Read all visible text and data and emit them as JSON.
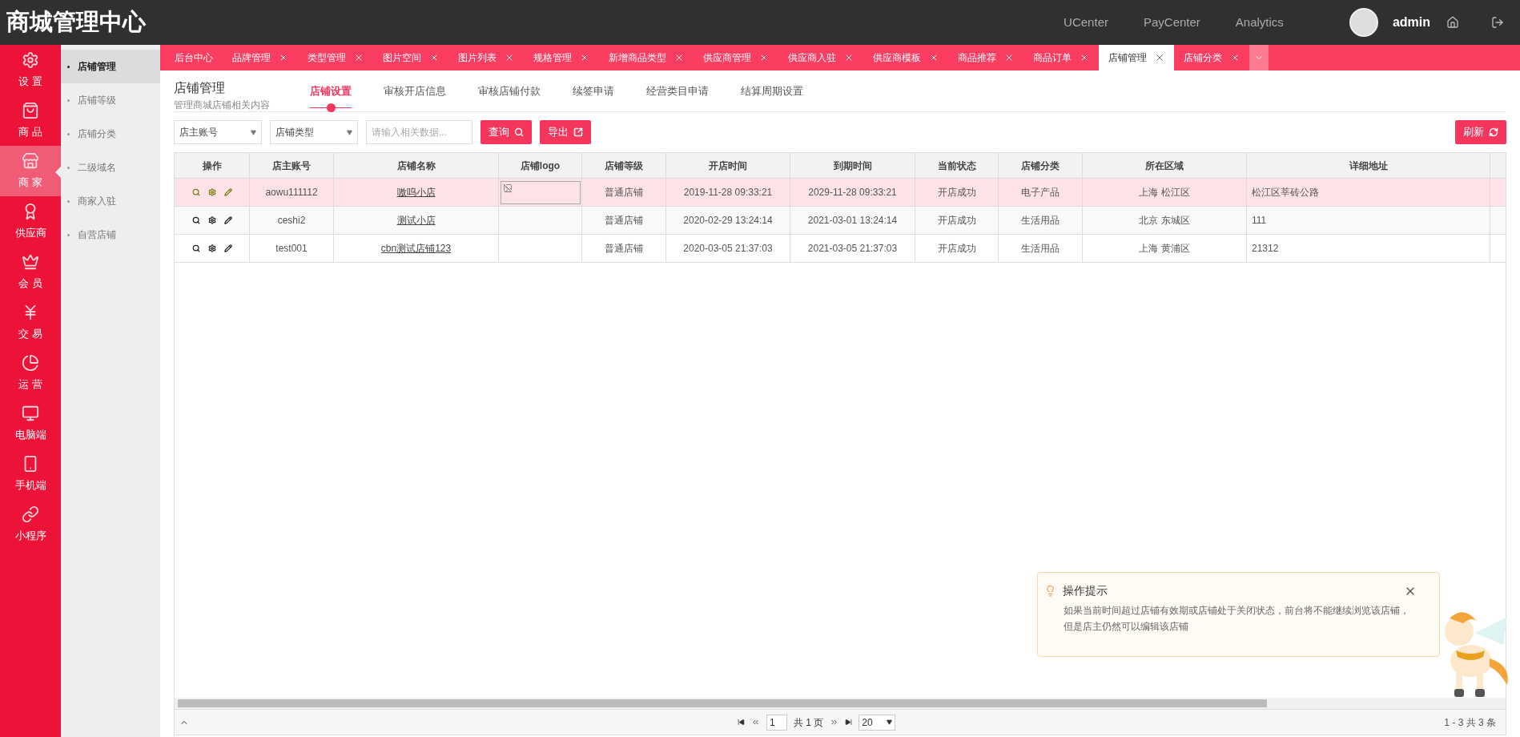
{
  "header": {
    "title": "商城管理中心",
    "links": [
      "UCenter",
      "PayCenter",
      "Analytics"
    ],
    "user": "admin"
  },
  "nav": [
    {
      "label": "设 置",
      "selected": false
    },
    {
      "label": "商 品",
      "selected": false
    },
    {
      "label": "商 家",
      "selected": true
    },
    {
      "label": "供应商",
      "selected": false
    },
    {
      "label": "会 员",
      "selected": false
    },
    {
      "label": "交 易",
      "selected": false
    },
    {
      "label": "运 营",
      "selected": false
    },
    {
      "label": "电脑端",
      "selected": false
    },
    {
      "label": "手机端",
      "selected": false
    },
    {
      "label": "小程序",
      "selected": false
    }
  ],
  "subnav": [
    {
      "label": "店铺管理",
      "selected": true
    },
    {
      "label": "店铺等级",
      "selected": false
    },
    {
      "label": "店铺分类",
      "selected": false
    },
    {
      "label": "二级域名",
      "selected": false
    },
    {
      "label": "商家入驻",
      "selected": false
    },
    {
      "label": "自营店铺",
      "selected": false
    }
  ],
  "tabs": [
    {
      "label": "后台中心",
      "selected": false,
      "closable": false
    },
    {
      "label": "品牌管理",
      "selected": false,
      "closable": true
    },
    {
      "label": "类型管理",
      "selected": false,
      "closable": true
    },
    {
      "label": "图片空间",
      "selected": false,
      "closable": true
    },
    {
      "label": "图片列表",
      "selected": false,
      "closable": true
    },
    {
      "label": "规格管理",
      "selected": false,
      "closable": true
    },
    {
      "label": "新增商品类型",
      "selected": false,
      "closable": true
    },
    {
      "label": "供应商管理",
      "selected": false,
      "closable": true
    },
    {
      "label": "供应商入驻",
      "selected": false,
      "closable": true
    },
    {
      "label": "供应商模板",
      "selected": false,
      "closable": true
    },
    {
      "label": "商品推荐",
      "selected": false,
      "closable": true
    },
    {
      "label": "商品订单",
      "selected": false,
      "closable": true
    },
    {
      "label": "店铺管理",
      "selected": true,
      "closable": true
    },
    {
      "label": "店铺分类",
      "selected": false,
      "closable": true
    }
  ],
  "page": {
    "title": "店铺管理",
    "subtitle": "管理商城店铺相关内容",
    "tabs": [
      {
        "label": "店铺设置",
        "selected": true
      },
      {
        "label": "审核开店信息",
        "selected": false
      },
      {
        "label": "审核店铺付款",
        "selected": false
      },
      {
        "label": "续签申请",
        "selected": false
      },
      {
        "label": "经营类目申请",
        "selected": false
      },
      {
        "label": "结算周期设置",
        "selected": false
      }
    ]
  },
  "filters": {
    "selects": [
      "店主账号",
      "店铺类型"
    ],
    "search_placeholder": "请输入相关数据...",
    "query": "查询",
    "export": "导出",
    "refresh": "刷新"
  },
  "table": {
    "columns": [
      "操作",
      "店主账号",
      "店铺名称",
      "店铺logo",
      "店铺等级",
      "开店时间",
      "到期时间",
      "当前状态",
      "店铺分类",
      "所在区域",
      "详细地址"
    ],
    "rows": [
      {
        "selected": true,
        "has_logo": true,
        "cells": [
          "",
          "aowu111112",
          "嗷呜小店",
          "",
          "普通店铺",
          "2019-11-28 09:33:21",
          "2029-11-28 09:33:21",
          "开店成功",
          "电子产品",
          "上海 松江区",
          "松江区莘砖公路"
        ]
      },
      {
        "selected": false,
        "has_logo": false,
        "cells": [
          "",
          "ceshi2",
          "测试小店",
          "",
          "普通店铺",
          "2020-02-29 13:24:14",
          "2021-03-01 13:24:14",
          "开店成功",
          "生活用品",
          "北京 东城区",
          "111"
        ]
      },
      {
        "selected": false,
        "has_logo": false,
        "cells": [
          "",
          "test001",
          "cbn测试店铺123",
          "",
          "普通店铺",
          "2020-03-05 21:37:03",
          "2021-03-05 21:37:03",
          "开店成功",
          "生活用品",
          "上海 黄浦区",
          "21312"
        ]
      }
    ]
  },
  "pager": {
    "page": "1",
    "pages": "共 1 页",
    "per_page": "20",
    "summary": "1 - 3 共 3 条"
  },
  "tip": {
    "title": "操作提示",
    "text": "如果当前时间超过店铺有效期或店铺处于关闭状态，前台将不能继续浏览该店铺，但是店主仍然可以编辑该店铺"
  }
}
